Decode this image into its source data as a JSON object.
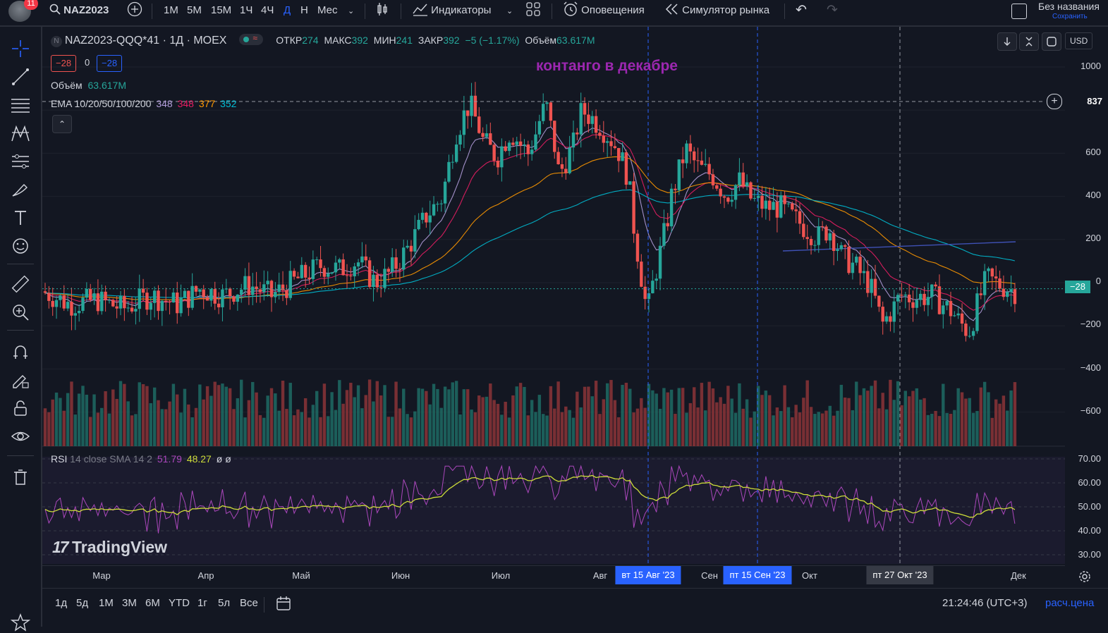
{
  "header": {
    "notifications_count": "11",
    "symbol_search": "NAZ2023",
    "intervals": [
      "1М",
      "5М",
      "15М",
      "1Ч",
      "4Ч",
      "Д",
      "Н",
      "Мес"
    ],
    "active_interval": "Д",
    "indicators_label": "Индикаторы",
    "alerts_label": "Оповещения",
    "replay_label": "Симулятор рынка",
    "layout_name": "Без названия",
    "save_label": "Сохранить"
  },
  "legend": {
    "title": "NAZ2023-QQQ*41 · 1Д · MOEX",
    "open_label": "ОТКР",
    "open": "274",
    "high_label": "МАКС",
    "high": "392",
    "low_label": "МИН",
    "low": "241",
    "close_label": "ЗАКР",
    "close": "392",
    "change": "−5 (−1.17%)",
    "volume_label": "Объём",
    "volume": "63.617M",
    "bid": "−28",
    "spread": "0",
    "ask": "−28",
    "vol_indicator_label": "Объём",
    "vol_indicator_value": "63.617M",
    "ema_label": "EMA 10/20/50/100/200",
    "ema_values": [
      "348",
      "348",
      "377",
      "352"
    ],
    "rsi_label": "RSI",
    "rsi_params": "14 close SMA 14 2",
    "rsi_value": "51.79",
    "rsi_sma_value": "48.27",
    "rsi_extra": "ø ø"
  },
  "annotation": "контанго в декабре",
  "price_axis": {
    "currency": "USD",
    "ticks": [
      "1000",
      "600",
      "400",
      "200",
      "0",
      "−200",
      "−400",
      "−600"
    ],
    "crosshair_price": "837",
    "last_price": "−28",
    "rsi_ticks": [
      "70.00",
      "60.00",
      "50.00",
      "40.00",
      "30.00"
    ]
  },
  "time_axis": {
    "months": [
      "Мар",
      "Апр",
      "Май",
      "Июн",
      "Июл",
      "Авг",
      "Сен",
      "Окт",
      "Дек"
    ],
    "markers": [
      {
        "label": "вт 15 Авг '23",
        "color": "#2962ff"
      },
      {
        "label": "пт 15 Сен '23",
        "color": "#2962ff"
      },
      {
        "label": "пт 27 Окт '23",
        "color": "#363a45"
      }
    ]
  },
  "watermark": "TradingView",
  "bottom": {
    "ranges": [
      "1д",
      "5д",
      "1М",
      "3М",
      "6М",
      "YTD",
      "1г",
      "5л",
      "Все"
    ],
    "clock": "21:24:46 (UTC+3)",
    "price_scale_label": "расч.цена"
  },
  "colors": {
    "up": "#26a69a",
    "down": "#ef5350",
    "ema10": "#e0e3eb",
    "ema20": "#e91e63",
    "ema50": "#ff9800",
    "ema100": "#00bcd4",
    "ema200": "#3f51b5",
    "rsi": "#ab47bc",
    "rsi_sma": "#cddc39",
    "annotation": "#9c27b0"
  }
}
